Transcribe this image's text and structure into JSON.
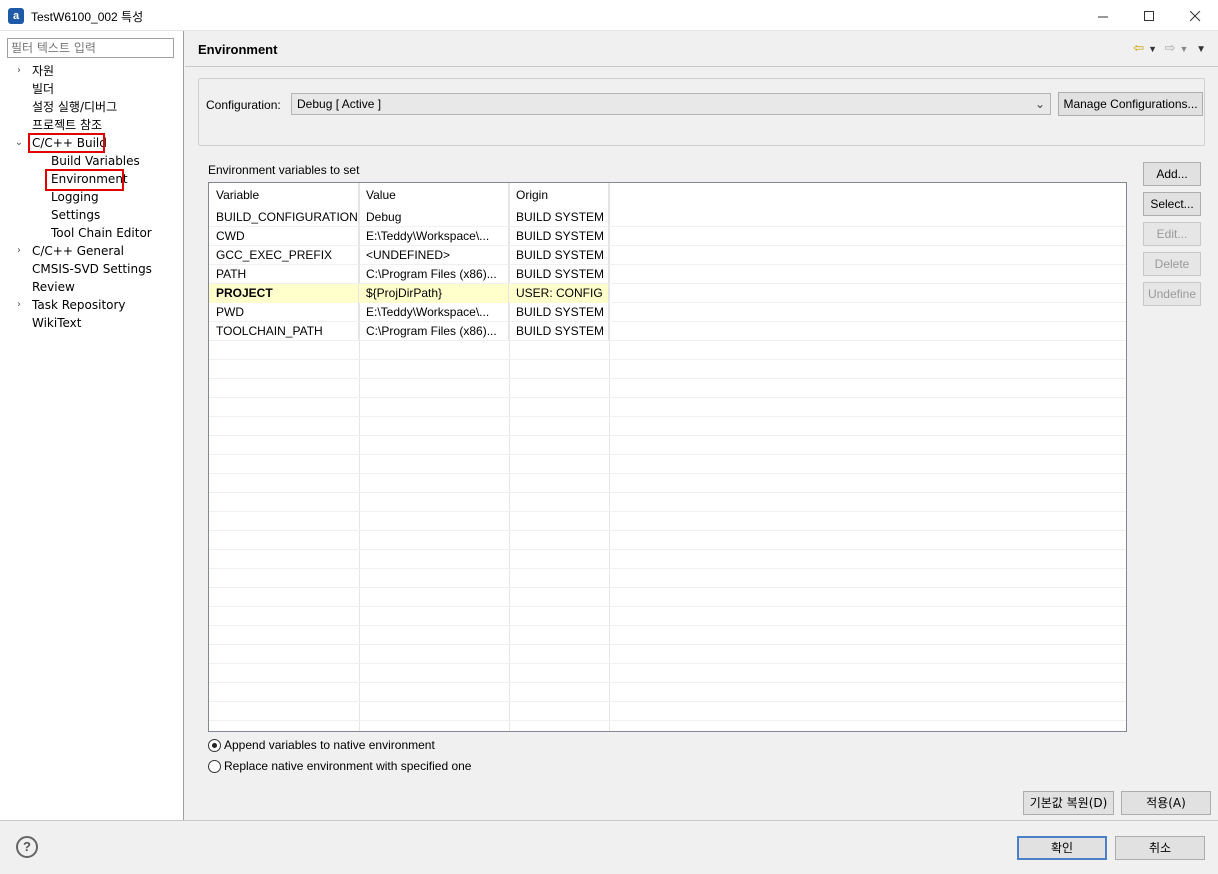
{
  "window": {
    "title": "TestW6100_002 특성",
    "app_icon": "a",
    "minimize_icon": "minimize-icon",
    "maximize_icon": "maximize-icon",
    "close_icon": "close-icon"
  },
  "sidebar": {
    "filter_placeholder": "필터 텍스트 입력",
    "items": [
      {
        "label": "자원",
        "expandable": true
      },
      {
        "label": "빌더"
      },
      {
        "label": "설정 실행/디버그"
      },
      {
        "label": "프로젝트 참조"
      },
      {
        "label": "C/C++ Build",
        "expanded": true,
        "highlighted": true
      },
      {
        "label": "Build Variables"
      },
      {
        "label": "Environment",
        "selected": true,
        "highlighted": true
      },
      {
        "label": "Logging"
      },
      {
        "label": "Settings"
      },
      {
        "label": "Tool Chain Editor"
      },
      {
        "label": "C/C++ General",
        "expandable": true
      },
      {
        "label": "CMSIS-SVD Settings"
      },
      {
        "label": "Review"
      },
      {
        "label": "Task Repository",
        "expandable": true
      },
      {
        "label": "WikiText"
      }
    ]
  },
  "main": {
    "title": "Environment",
    "configuration_label": "Configuration:",
    "configuration_value": "Debug  [ Active ]",
    "manage_configurations": "Manage Configurations...",
    "env_vars_label": "Environment variables to set",
    "columns": [
      "Variable",
      "Value",
      "Origin"
    ],
    "rows": [
      {
        "variable": "BUILD_CONFIGURATION",
        "value": "Debug",
        "origin": "BUILD SYSTEM"
      },
      {
        "variable": "CWD",
        "value": "E:\\Teddy\\Workspace\\...",
        "origin": "BUILD SYSTEM"
      },
      {
        "variable": "GCC_EXEC_PREFIX",
        "value": "<UNDEFINED>",
        "origin": "BUILD SYSTEM"
      },
      {
        "variable": "PATH",
        "value": "C:\\Program Files (x86)...",
        "origin": "BUILD SYSTEM"
      },
      {
        "variable": "PROJECT",
        "value": "${ProjDirPath}",
        "origin": "USER: CONFIG",
        "highlight": true
      },
      {
        "variable": "PWD",
        "value": "E:\\Teddy\\Workspace\\...",
        "origin": "BUILD SYSTEM"
      },
      {
        "variable": "TOOLCHAIN_PATH",
        "value": "C:\\Program Files (x86)...",
        "origin": "BUILD SYSTEM"
      }
    ],
    "buttons": {
      "add": "Add...",
      "select": "Select...",
      "edit": "Edit...",
      "delete": "Delete",
      "undefine": "Undefine"
    },
    "radio_append": "Append variables to native environment",
    "radio_replace": "Replace native environment with specified one",
    "restore_defaults": "기본값 복원(D)",
    "apply": "적용(A)"
  },
  "footer": {
    "ok": "확인",
    "cancel": "취소",
    "help_icon": "help-icon"
  },
  "colors": {
    "highlight_box": "#e00000",
    "row_highlight": "#ffffcc",
    "nav_arrow": "#c9a200"
  }
}
